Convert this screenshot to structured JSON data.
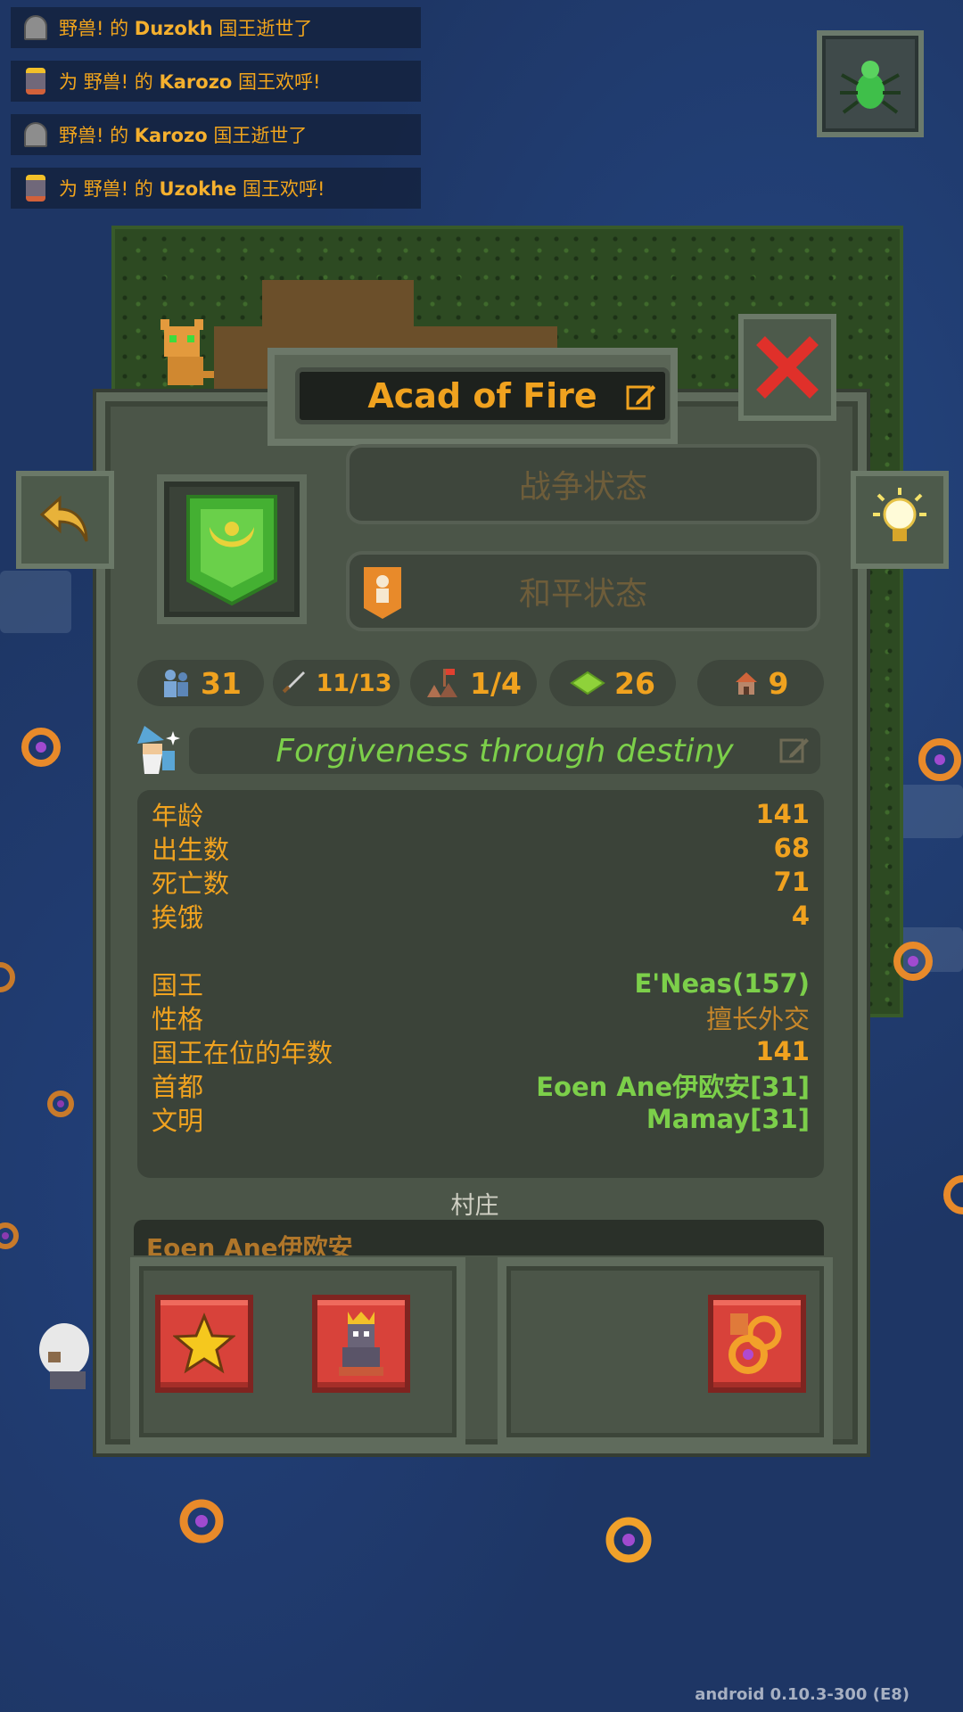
{
  "feed": [
    {
      "icon": "grave-icon",
      "prefix": "",
      "kingdom": "野兽!",
      "mid": " 的 ",
      "name": "Duzokh",
      "suffix": " 国王逝世了"
    },
    {
      "icon": "king-icon",
      "prefix": "为 ",
      "kingdom": "野兽!",
      "mid": " 的 ",
      "name": "Karozo",
      "suffix": " 国王欢呼!"
    },
    {
      "icon": "grave-icon",
      "prefix": "",
      "kingdom": "野兽!",
      "mid": " 的 ",
      "name": "Karozo",
      "suffix": " 国王逝世了"
    },
    {
      "icon": "king-icon",
      "prefix": "为 ",
      "kingdom": "野兽!",
      "mid": " 的 ",
      "name": "Uzokhe",
      "suffix": " 国王欢呼!"
    }
  ],
  "window": {
    "title": "Acad of Fire",
    "war_state": "战争状态",
    "peace_state": "和平状态",
    "motto": "Forgiveness through destiny"
  },
  "stats": {
    "population": "31",
    "army": "11/13",
    "cities": "1/4",
    "territory": "26",
    "buildings": "9"
  },
  "info": {
    "age_label": "年龄",
    "age": "141",
    "births_label": "出生数",
    "births": "68",
    "deaths_label": "死亡数",
    "deaths": "71",
    "starved_label": "挨饿",
    "starved": "4",
    "king_label": "国王",
    "king": "E'Neas(157)",
    "trait_label": "性格",
    "trait": "擅长外交",
    "reign_label": "国王在位的年数",
    "reign": "141",
    "capital_label": "首都",
    "capital": "Eoen Ane伊欧安[31]",
    "culture_label": "文明",
    "culture": "Mamay[31]"
  },
  "villages": {
    "label": "村庄",
    "first_village_partial": "Eoen Ane伊欧安"
  },
  "version": "android 0.10.3-300 (E8)",
  "colors": {
    "accent_orange": "#f0a21f",
    "green_text": "#7ccf4a",
    "panel": "#4b5548",
    "ocean": "#1e3665",
    "action_red": "#d8423a"
  }
}
